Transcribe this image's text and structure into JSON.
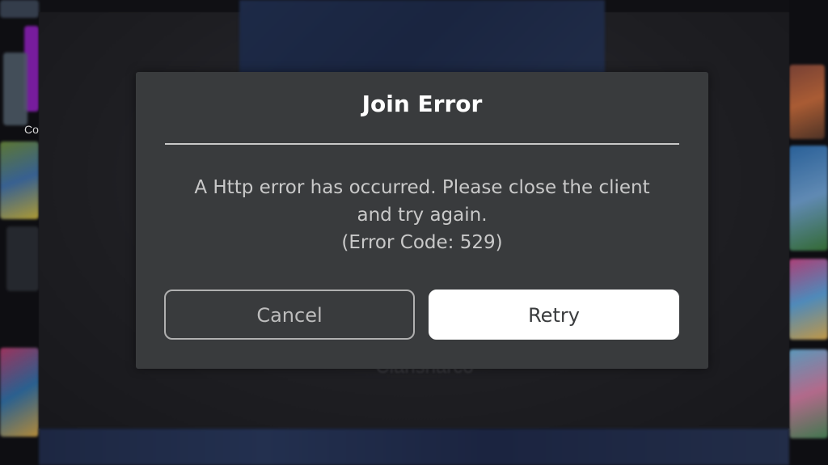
{
  "dialog": {
    "title": "Join Error",
    "message_line1": "A Http error has occurred. Please close the client",
    "message_line2": "and try again.",
    "error_code": "(Error Code: 529)",
    "cancel_label": "Cancel",
    "retry_label": "Retry"
  },
  "background": {
    "partial_label": "Co",
    "obscured_text": "Clarisharco"
  },
  "colors": {
    "modal_bg": "#393b3d",
    "retry_bg": "#ffffff",
    "cancel_border": "#b0b0b0",
    "title_text": "#ffffff",
    "body_text": "#c9c9c9",
    "accent_purple": "#8a1fb6"
  }
}
